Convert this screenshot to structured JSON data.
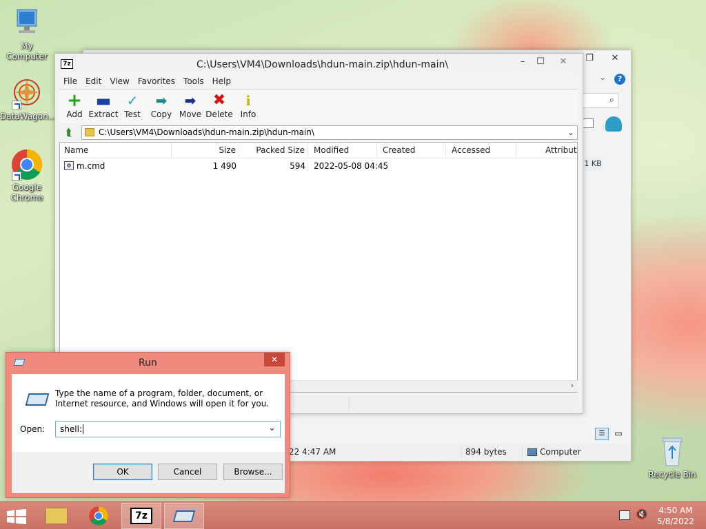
{
  "desktop": {
    "icons": [
      {
        "label": "My Computer",
        "icon": "computer-icon"
      },
      {
        "label": "DataWagon...",
        "icon": "datawagon-icon"
      },
      {
        "label": "Google Chrome",
        "icon": "chrome-icon"
      },
      {
        "label": "Recycle Bin",
        "icon": "recycle-bin-icon"
      }
    ]
  },
  "explorer": {
    "size_value": "1 KB",
    "status_date": "22 4:47 AM",
    "status_size": "894 bytes",
    "status_location": "Computer"
  },
  "zip": {
    "title": "C:\\Users\\VM4\\Downloads\\hdun-main.zip\\hdun-main\\",
    "menu": [
      "File",
      "Edit",
      "View",
      "Favorites",
      "Tools",
      "Help"
    ],
    "toolbar": [
      {
        "label": "Add",
        "icon": "add-icon",
        "color": "#1aa51a"
      },
      {
        "label": "Extract",
        "icon": "extract-icon",
        "color": "#1f3fa8"
      },
      {
        "label": "Test",
        "icon": "test-icon",
        "color": "#2aa5b9"
      },
      {
        "label": "Copy",
        "icon": "copy-icon",
        "color": "#1f8f8f"
      },
      {
        "label": "Move",
        "icon": "move-icon",
        "color": "#1a2f8f"
      },
      {
        "label": "Delete",
        "icon": "delete-icon",
        "color": "#d01414"
      },
      {
        "label": "Info",
        "icon": "info-icon",
        "color": "#d7c51a"
      }
    ],
    "address": "C:\\Users\\VM4\\Downloads\\hdun-main.zip\\hdun-main\\",
    "columns": [
      "Name",
      "Size",
      "Packed Size",
      "Modified",
      "Created",
      "Accessed",
      "Attribute"
    ],
    "rows": [
      {
        "name": "m.cmd",
        "size": "1 490",
        "packed": "594",
        "modified": "2022-05-08 04:45",
        "created": "",
        "accessed": "",
        "attributes": ""
      }
    ]
  },
  "run": {
    "title": "Run",
    "description": "Type the name of a program, folder, document, or Internet resource, and Windows will open it for you.",
    "open_label": "Open:",
    "open_value": "shell:",
    "ok": "OK",
    "cancel": "Cancel",
    "browse": "Browse..."
  },
  "taskbar": {
    "time": "4:50 AM",
    "date": "5/8/2022",
    "apps": [
      "file-explorer-icon",
      "chrome-icon",
      "7zip-icon",
      "run-icon"
    ]
  }
}
